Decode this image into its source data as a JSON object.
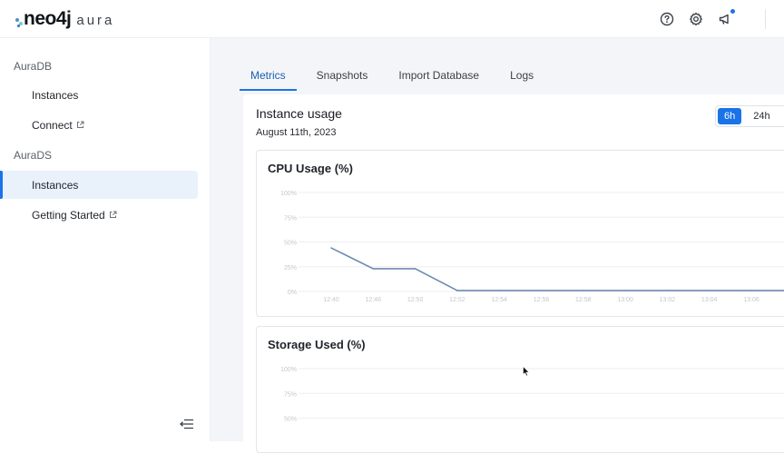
{
  "brand": {
    "name": "neo4j",
    "product": "aura"
  },
  "topbar": {
    "icons": [
      "help-icon",
      "settings-icon",
      "announcement-icon"
    ]
  },
  "sidebar": {
    "sections": [
      {
        "label": "AuraDB",
        "items": [
          {
            "label": "Instances",
            "external": false,
            "active": false
          },
          {
            "label": "Connect",
            "external": true,
            "active": false
          }
        ]
      },
      {
        "label": "AuraDS",
        "items": [
          {
            "label": "Instances",
            "external": false,
            "active": true
          },
          {
            "label": "Getting Started",
            "external": true,
            "active": false
          }
        ]
      }
    ]
  },
  "tabs": [
    {
      "label": "Metrics",
      "active": true
    },
    {
      "label": "Snapshots",
      "active": false
    },
    {
      "label": "Import Database",
      "active": false
    },
    {
      "label": "Logs",
      "active": false
    }
  ],
  "usage": {
    "title": "Instance usage",
    "date": "August 11th, 2023",
    "ranges": [
      {
        "label": "6h",
        "active": true
      },
      {
        "label": "24h",
        "active": false
      }
    ]
  },
  "colors": {
    "accent": "#1a73e8",
    "line": "#6f8bb3"
  },
  "chart_data": [
    {
      "type": "line",
      "title": "CPU Usage (%)",
      "ylim": [
        0,
        100
      ],
      "y_ticks": [
        "100%",
        "75%",
        "50%",
        "25%",
        "0%"
      ],
      "categories": [
        "12:40",
        "12:46",
        "12:50",
        "12:52",
        "12:54",
        "12:56",
        "12:58",
        "13:00",
        "13:02",
        "13:04",
        "13:06"
      ],
      "series": [
        {
          "values": [
            44,
            23,
            23,
            1,
            1,
            1,
            1,
            1,
            1,
            1,
            1
          ]
        }
      ]
    },
    {
      "type": "line",
      "title": "Storage Used (%)",
      "ylim": [
        0,
        100
      ],
      "y_ticks": [
        "100%",
        "75%",
        "50%"
      ],
      "categories": [],
      "series": []
    }
  ]
}
